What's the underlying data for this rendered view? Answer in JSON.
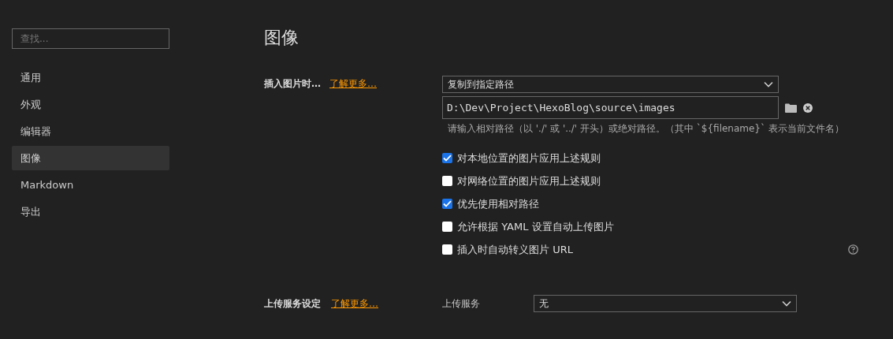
{
  "sidebar": {
    "search": {
      "placeholder": "查找..."
    },
    "items": [
      {
        "label": "通用",
        "selected": false
      },
      {
        "label": "外观",
        "selected": false
      },
      {
        "label": "编辑器",
        "selected": false
      },
      {
        "label": "图像",
        "selected": true
      },
      {
        "label": "Markdown",
        "selected": false
      },
      {
        "label": "导出",
        "selected": false
      }
    ]
  },
  "page": {
    "title": "图像",
    "insert_section": {
      "label": "插入图片时…",
      "link": "了解更多…",
      "action_select": "复制到指定路径",
      "path_input": "D:\\Dev\\Project\\HexoBlog\\source\\images",
      "hint": "请输入相对路径（以 './' 或 '../' 开头）或绝对路径。（其中 `${filename}` 表示当前文件名）",
      "options": [
        {
          "label": "对本地位置的图片应用上述规则",
          "checked": true
        },
        {
          "label": "对网络位置的图片应用上述规则",
          "checked": false
        },
        {
          "label": "优先使用相对路径",
          "checked": true
        },
        {
          "label": "允许根据 YAML 设置自动上传图片",
          "checked": false
        },
        {
          "label": "插入时自动转义图片 URL",
          "checked": false
        }
      ]
    },
    "upload_section": {
      "label": "上传服务设定",
      "link": "了解更多…",
      "field_label": "上传服务",
      "select": "无"
    }
  }
}
